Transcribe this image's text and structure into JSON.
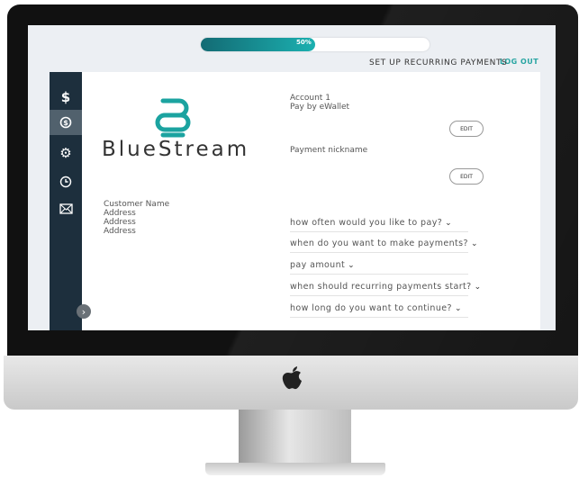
{
  "progress": {
    "percent": 50,
    "label": "50%"
  },
  "header": {
    "logout_label": "LOG OUT",
    "page_title": "SET UP RECURRING PAYMENTS"
  },
  "sidebar": {
    "items": [
      {
        "icon": "dollar-icon",
        "glyph": "$"
      },
      {
        "icon": "recurring-dollar-icon",
        "glyph": "⟲",
        "active": true
      },
      {
        "icon": "gear-icon",
        "glyph": "⚙"
      },
      {
        "icon": "clock-icon",
        "glyph": "◷"
      },
      {
        "icon": "mail-icon",
        "glyph": "✉"
      }
    ],
    "collapse_glyph": "›"
  },
  "brand": {
    "name": "BlueStream",
    "accent": "#1ba3a0"
  },
  "customer": {
    "name": "Customer Name",
    "address_lines": [
      "Address",
      "Address",
      "Address"
    ]
  },
  "account": {
    "line1": "Account 1",
    "line2": "Pay by eWallet",
    "edit_label": "EDIT"
  },
  "nickname": {
    "label": "Payment nickname",
    "edit_label": "EDIT"
  },
  "questions": [
    "how often would you like to pay?",
    "when do you want to make payments?",
    "pay amount",
    "when should recurring payments start?",
    "how long do you want to continue?"
  ],
  "chevron_glyph": "⌄"
}
